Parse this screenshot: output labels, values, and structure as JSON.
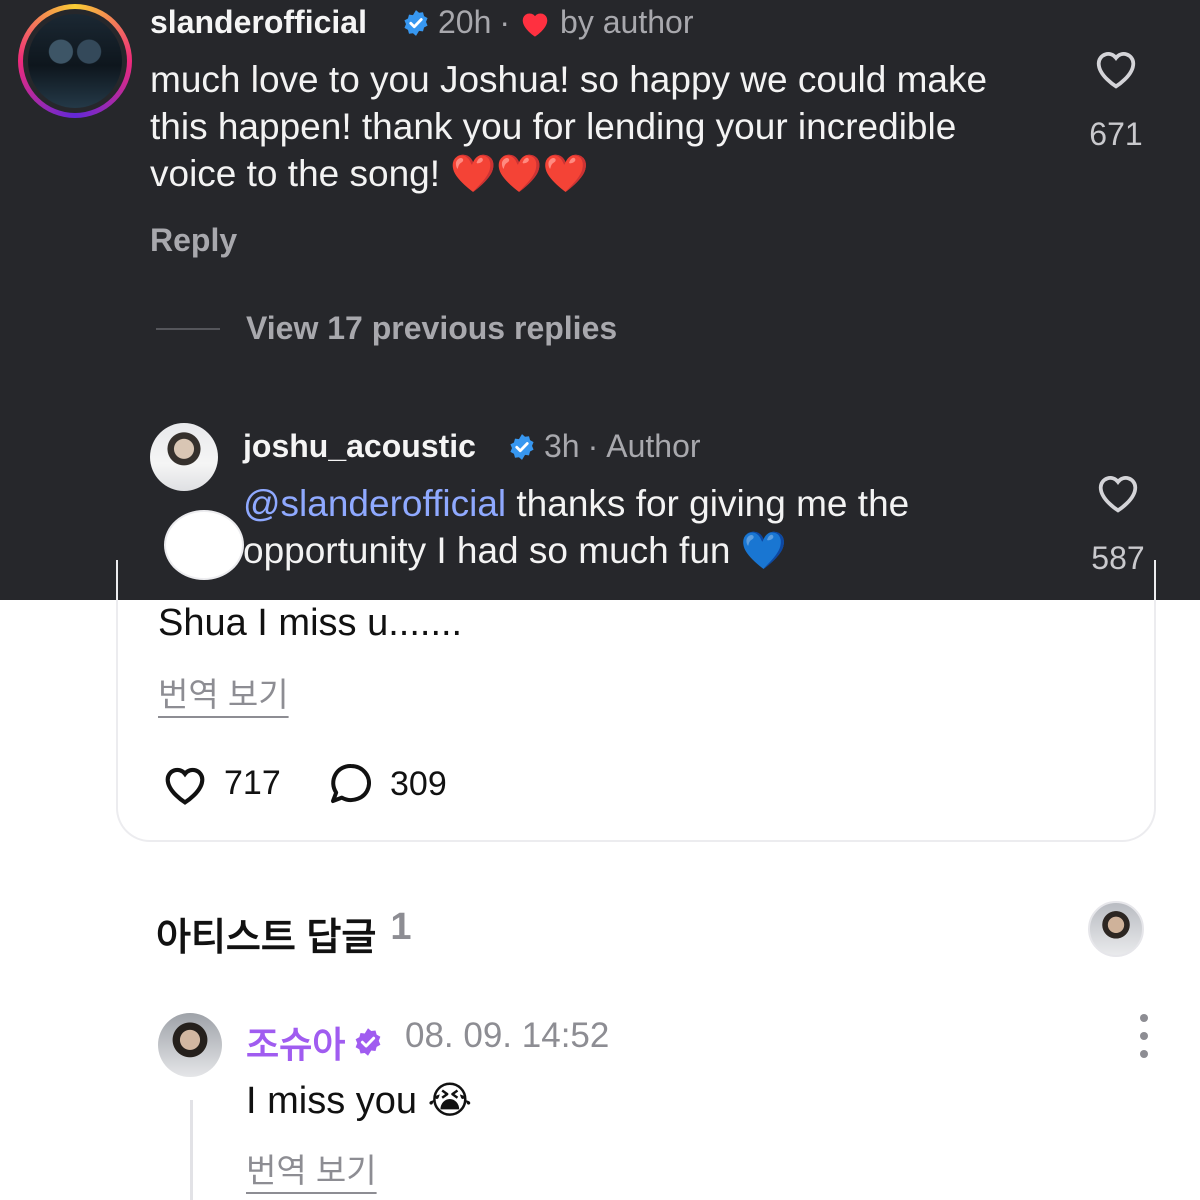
{
  "instagram": {
    "comment": {
      "username": "slanderofficial",
      "time": "20h",
      "separator": "·",
      "liked_by_author": "by author",
      "text": "much love to you Joshua! so happy we could make this happen! thank you for lending your incredible voice to the song! ❤️❤️❤️",
      "reply_label": "Reply",
      "like_count": "671"
    },
    "view_replies": "View 17 previous replies",
    "reply": {
      "username": "joshu_acoustic",
      "time": "3h",
      "separator": "·",
      "author_label": "Author",
      "mention": "@slanderofficial",
      "text": " thanks for giving me the opportunity I had so much fun 💙",
      "like_count": "587"
    }
  },
  "weverse": {
    "post": {
      "text": "Shua I miss u.......",
      "translate_label": "번역 보기",
      "like_count": "717",
      "comment_count": "309"
    },
    "artist_replies": {
      "title": "아티스트 답글",
      "count": "1"
    },
    "artist_reply": {
      "name": "조슈아",
      "date": "08. 09. 14:52",
      "text": "I miss you 😭",
      "translate_label": "번역 보기"
    }
  },
  "colors": {
    "dark_bg": "#26272b",
    "verified": "#3797f0",
    "mention": "#8fa9ff",
    "artist_name": "#a05cf0"
  }
}
